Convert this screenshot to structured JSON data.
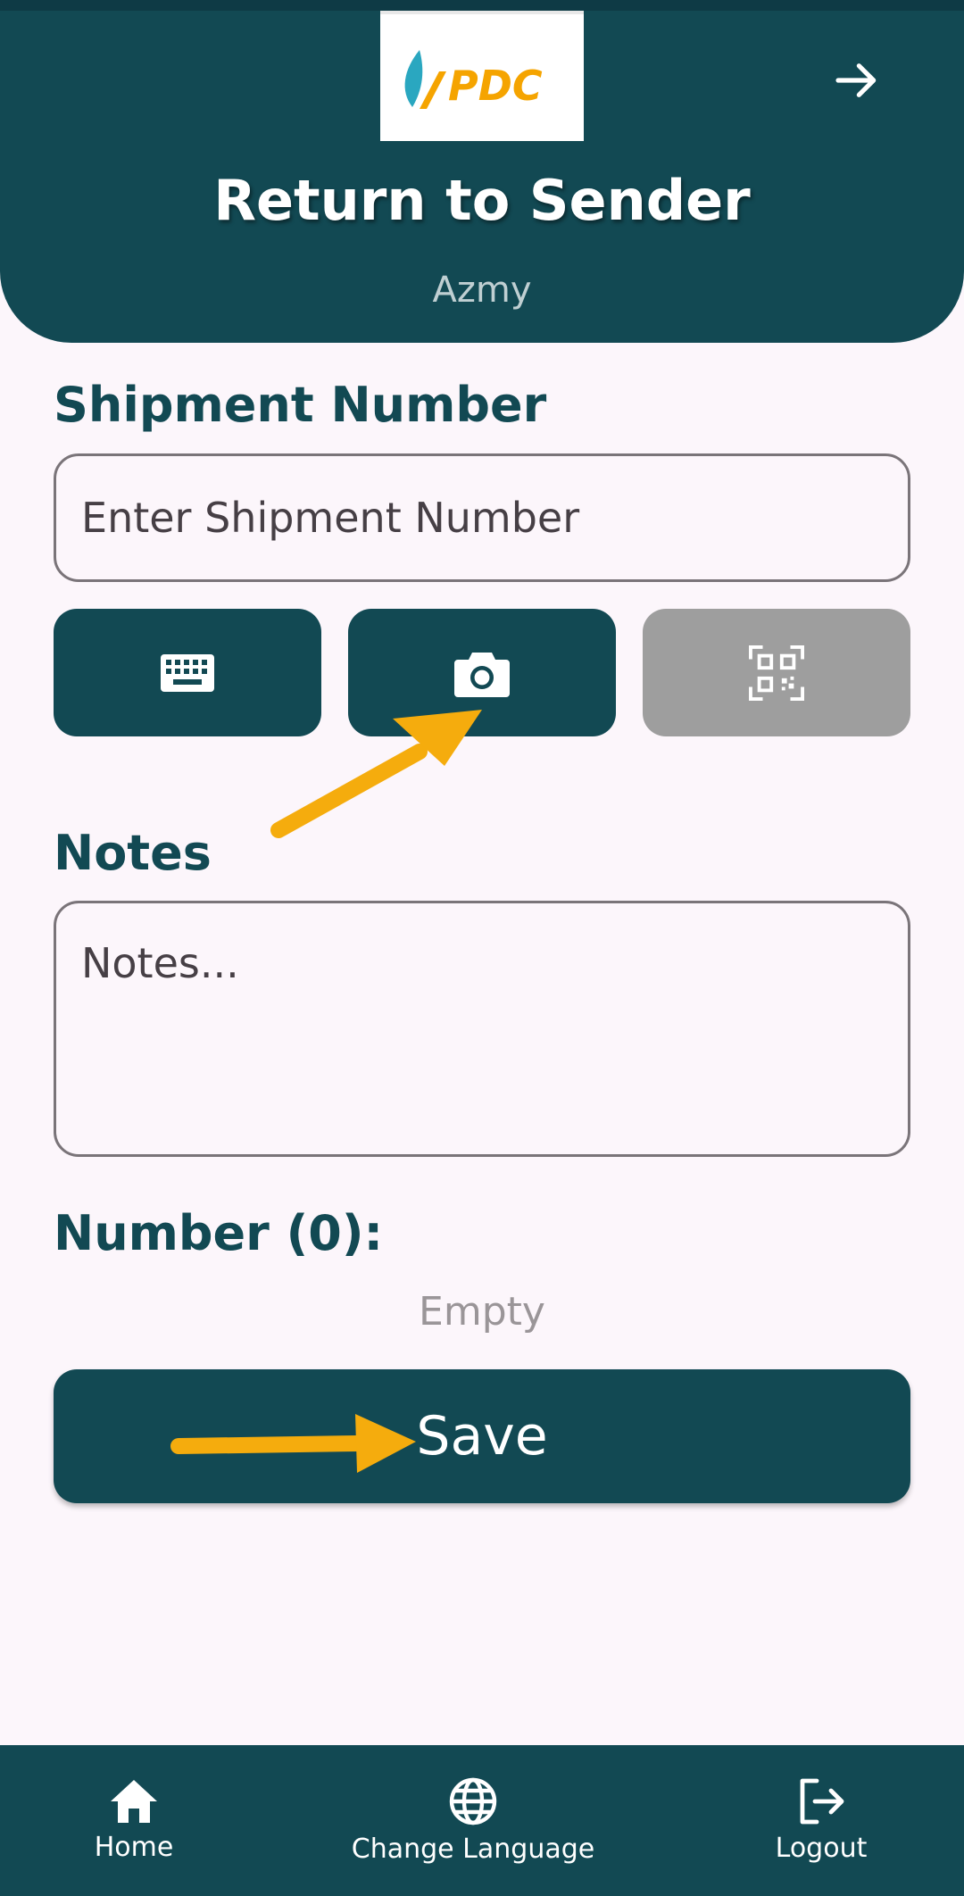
{
  "header": {
    "logo_text": "PDC",
    "title": "Return to Sender",
    "subtitle": "Azmy",
    "forward_icon": "arrow-right-icon"
  },
  "shipment": {
    "label": "Shipment Number",
    "placeholder": "Enter Shipment Number",
    "value": ""
  },
  "input_modes": [
    {
      "icon": "keyboard-icon",
      "enabled": true
    },
    {
      "icon": "camera-icon",
      "enabled": true
    },
    {
      "icon": "qr-code-icon",
      "enabled": false
    }
  ],
  "notes": {
    "label": "Notes",
    "placeholder": "Notes...",
    "value": ""
  },
  "number": {
    "label": "Number (0):",
    "empty_text": "Empty"
  },
  "save_label": "Save",
  "bottom_nav": [
    {
      "label": "Home",
      "icon": "home-icon"
    },
    {
      "label": "Change Language",
      "icon": "globe-icon"
    },
    {
      "label": "Logout",
      "icon": "logout-icon"
    }
  ],
  "colors": {
    "primary": "#124953",
    "background": "#fcf6fb",
    "disabled": "#9e9e9e",
    "annotation_arrow": "#f5ac0d",
    "logo_orange": "#f5a400",
    "logo_teal": "#2aa7c0"
  }
}
